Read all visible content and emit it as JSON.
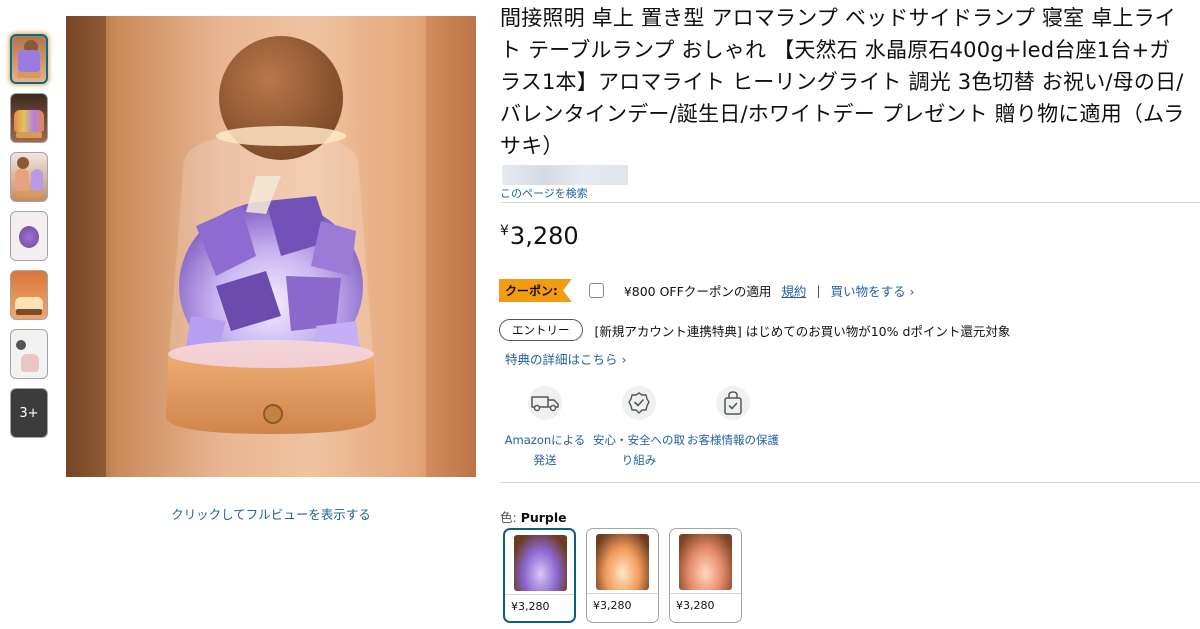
{
  "product": {
    "title": "間接照明 卓上 置き型 アロマランプ ベッドサイドランプ 寝室 卓上ライト テーブルランプ おしゃれ 【天然石 水晶原石400g+led台座1台+ガラス1本】アロマライト ヒーリングライト 調光 3色切替 お祝い/母の日/バレンタインデー/誕生日/ホワイトデー プレゼント 贈り物に適用（ムラサキ）",
    "search_this_page": "このページを検索",
    "price_symbol": "¥",
    "price_value": "3,280"
  },
  "gallery": {
    "more_label": "3+",
    "full_view_link": "クリックしてフルビューを表示する",
    "share_icon": "share-icon"
  },
  "coupon": {
    "badge": "クーポン:",
    "text": "¥800 OFFクーポンの適用",
    "terms_link": "規約",
    "separator": "|",
    "shop_link": "買い物をする ›"
  },
  "entry": {
    "pill": "エントリー",
    "text": "[新規アカウント連携特典] はじめてのお買い物が10% dポイント還元対象",
    "details_link": "特典の詳細はこちら ›"
  },
  "features": [
    {
      "icon": "delivery-van-icon",
      "label": "Amazonによる発送"
    },
    {
      "icon": "safety-badge-icon",
      "label": "安心・安全への取り組み"
    },
    {
      "icon": "secure-bag-icon",
      "label": "お客様情報の保護"
    }
  ],
  "variants": {
    "color_prefix": "色:",
    "selected_color": "Purple",
    "options": [
      {
        "price": "¥3,280"
      },
      {
        "price": "¥3,280"
      },
      {
        "price": "¥3,280"
      }
    ]
  },
  "colors": {
    "link": "#2162a1",
    "coupon_orange": "#f39c12",
    "selected_border": "#0a5f7a"
  }
}
